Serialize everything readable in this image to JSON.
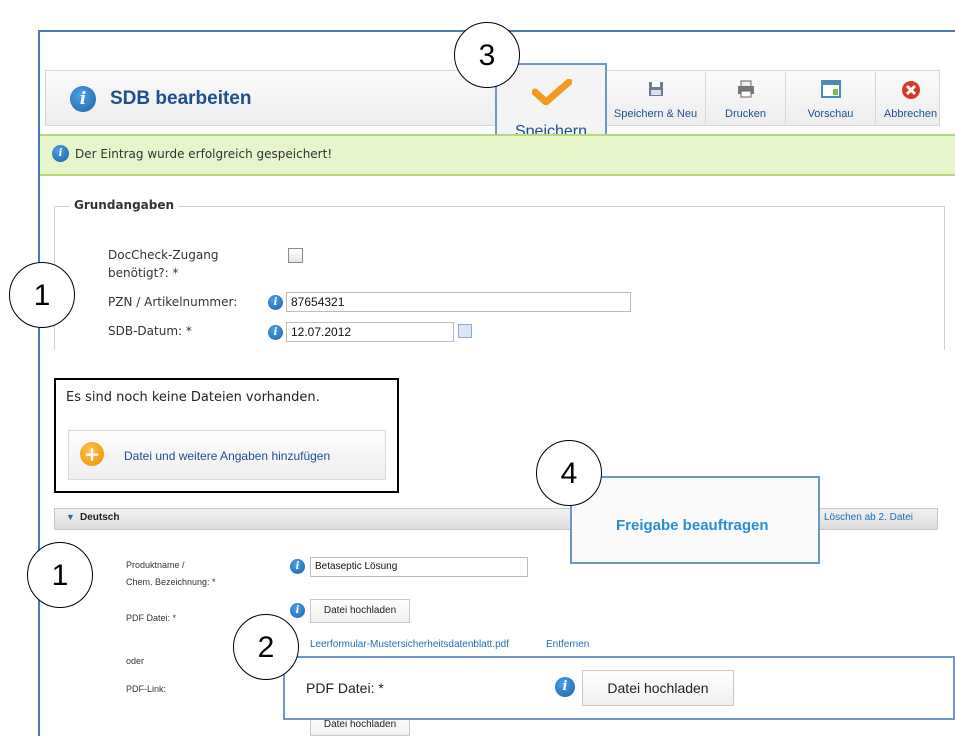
{
  "toolbar": {
    "title": "SDB bearbeiten",
    "save_label": "Speichern",
    "save_new_label": "Speichern & Neu",
    "print_label": "Drucken",
    "preview_label": "Vorschau",
    "cancel_label": "Abbrechen"
  },
  "message": {
    "text": "Der Eintrag wurde erfolgreich gespeichert!"
  },
  "grundangaben": {
    "legend": "Grundangaben",
    "doccheck_label_1": "DocCheck-Zugang",
    "doccheck_label_2": "benötigt?: *",
    "pzn_label": "PZN / Artikelnummer:",
    "pzn_value": "87654321",
    "date_label": "SDB-Datum:  *",
    "date_value": "12.07.2012"
  },
  "files": {
    "empty_text": "Es sind noch keine Dateien vorhanden.",
    "add_label": "Datei und weitere Angaben hinzufügen"
  },
  "language": {
    "name": "Deutsch",
    "delete_label": "Löschen ab 2. Datei",
    "freigabe_label": "Freigabe beauftragen",
    "product_label_1": "Produktname /",
    "product_label_2": "Chem. Bezeichnung:  *",
    "product_value": "Betaseptic Lösung",
    "pdf_label": "PDF Datei: *",
    "upload_label": "Datei hochladen",
    "file_name": "Leerformular-Mustersicherheitsdatenblatt.pdf",
    "remove_label": "Entfernen",
    "or_label": "oder",
    "pdf_link_label": "PDF-Link:",
    "upload_label_2": "Datei hochladen"
  },
  "zoom": {
    "pdf_label": "PDF Datei: *",
    "upload_label": "Datei hochladen"
  },
  "callouts": {
    "c1a": "1",
    "c1b": "1",
    "c2": "2",
    "c3": "3",
    "c4": "4"
  },
  "colors": {
    "accent": "#1d4f8c",
    "success_bg": "#e7f5cb",
    "callout_border": "#6d96cc"
  }
}
